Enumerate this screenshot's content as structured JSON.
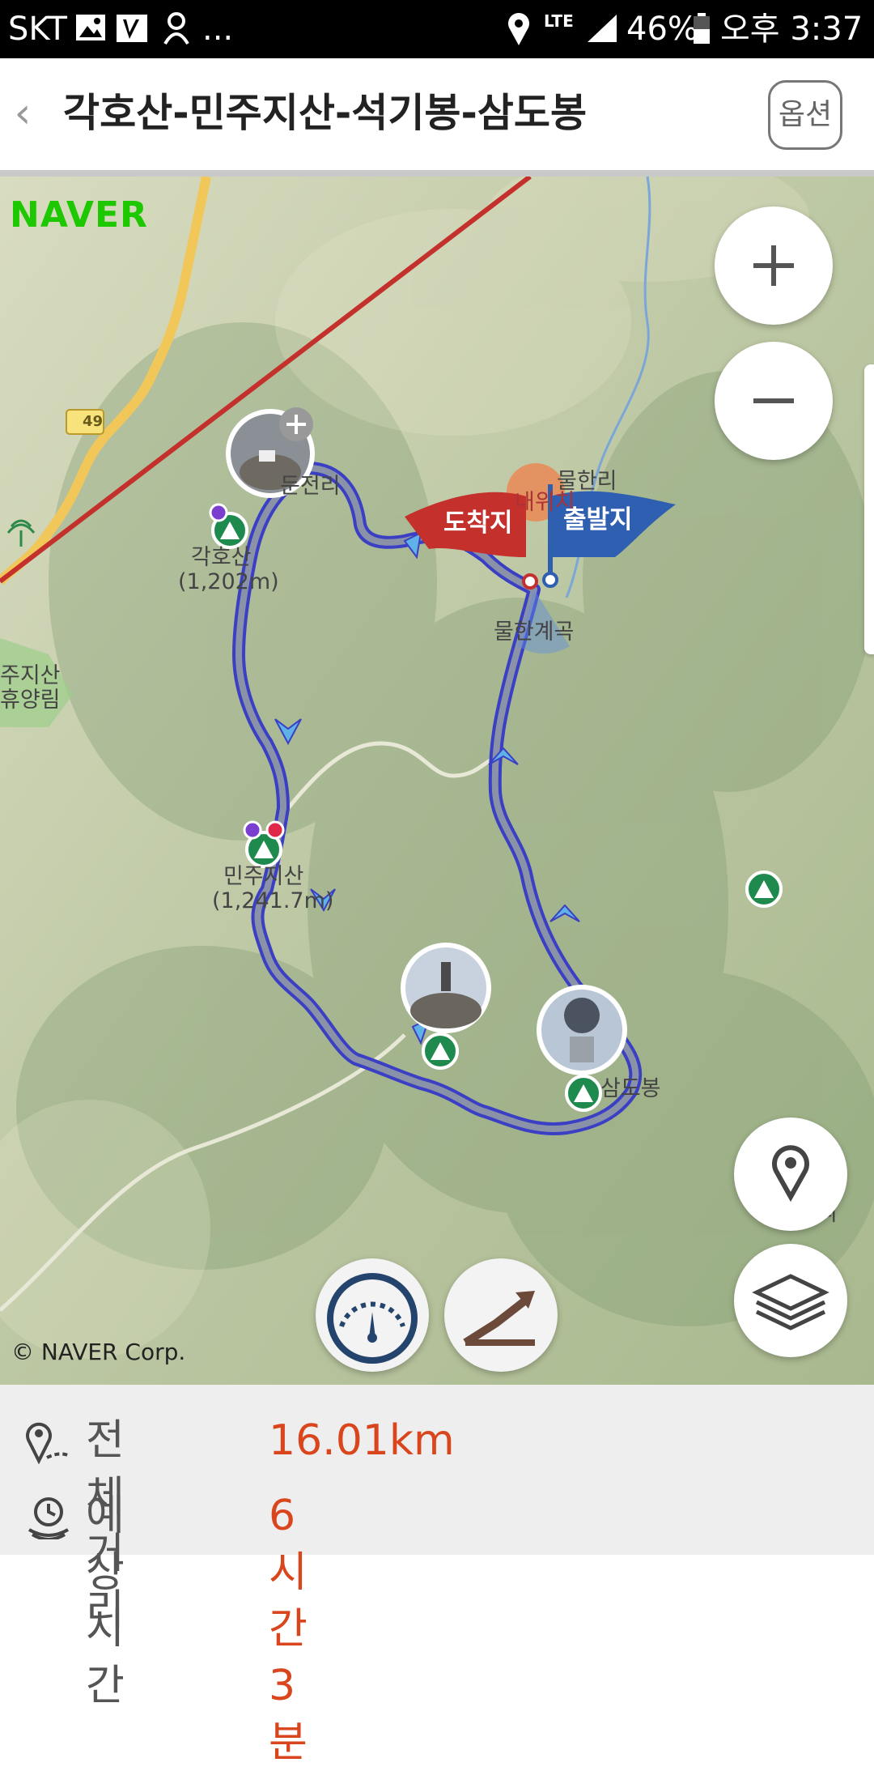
{
  "status_bar": {
    "carrier": "SKT",
    "extra": "...",
    "network": "LTE",
    "battery": "46%",
    "time": "오후 3:37"
  },
  "header": {
    "back_icon": "chevron-left-icon",
    "title": "각호산-민주지산-석기봉-삼도봉",
    "options_label": "옵션"
  },
  "map": {
    "provider_logo": "NAVER",
    "copyright": "© NAVER Corp.",
    "road_number": "49",
    "places": {
      "dunjeon": "둔전리",
      "mulhan": "물한리",
      "naewi": "내위치",
      "valley": "물한계곡",
      "forest_1": "주지산",
      "forest_2": "휴양림",
      "samdo": "삼도봉",
      "edge": "리"
    },
    "peaks": {
      "gakho_name": "각호산",
      "gakho_height": "(1,202m)",
      "minju_name": "민주지산",
      "minju_height": "(1,241.7m)"
    },
    "flags": {
      "arrival": "도착지",
      "departure": "출발지"
    },
    "controls": {
      "zoom_in": "plus-icon",
      "zoom_out": "minus-icon",
      "location": "location-pin-icon",
      "layers": "layers-icon",
      "speed": "speedometer-icon",
      "elevation": "elevation-icon"
    },
    "colors": {
      "route": "#3b3fc4",
      "route_inner": "#8a92a8",
      "peak_marker": "#1f8a4d",
      "arrival_flag": "#c4302b",
      "departure_flag": "#2f5fb0"
    }
  },
  "summary": {
    "distance_label": "전체거리",
    "distance_value": "16.01km",
    "time_label": "예상시간",
    "time_value": "6시간 3분"
  }
}
